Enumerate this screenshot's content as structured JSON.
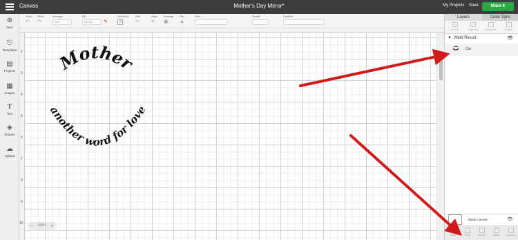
{
  "header": {
    "app_title": "Canvas",
    "document_title": "Mother's Day Mirror*",
    "my_projects": "My Projects",
    "save": "Save",
    "make_it": "Make It"
  },
  "toolbar": {
    "undo": "Undo",
    "redo": "Redo",
    "linetype": "Linetype",
    "linetype_value": "Cut",
    "fill": "Fill",
    "fill_value": "No Fill",
    "select_all": "Select All",
    "edit": "Edit",
    "align": "Align",
    "arrange": "Arrange",
    "flip": "Flip",
    "size": "Size",
    "rotate": "Rotate",
    "position": "Position"
  },
  "left_nav": [
    "New",
    "Templates",
    "Projects",
    "Images",
    "Text",
    "Shapes",
    "Upload"
  ],
  "ruler_left": [
    "2",
    "3",
    "4",
    "5",
    "6",
    "7",
    "8",
    "9",
    "10"
  ],
  "canvas": {
    "text_top": "Mother",
    "text_arc": "another word for love",
    "zoom_value": "100%"
  },
  "right_panel": {
    "tabs": [
      "Layers",
      "Color Sync"
    ],
    "layer_actions": [
      "Group",
      "Ungroup",
      "Duplicate",
      "Delete"
    ],
    "layer_group": "Weld Result",
    "layer_item_op": "Cut",
    "blank_canvas": "Blank Canvas",
    "bottom_actions": [
      "Slice",
      "Weld",
      "Attach",
      "Flatten",
      "Contour"
    ]
  },
  "colors": {
    "header_bg": "#3c3c3c",
    "make_it_green": "#27a844",
    "arrow_red": "#d11b1b"
  }
}
